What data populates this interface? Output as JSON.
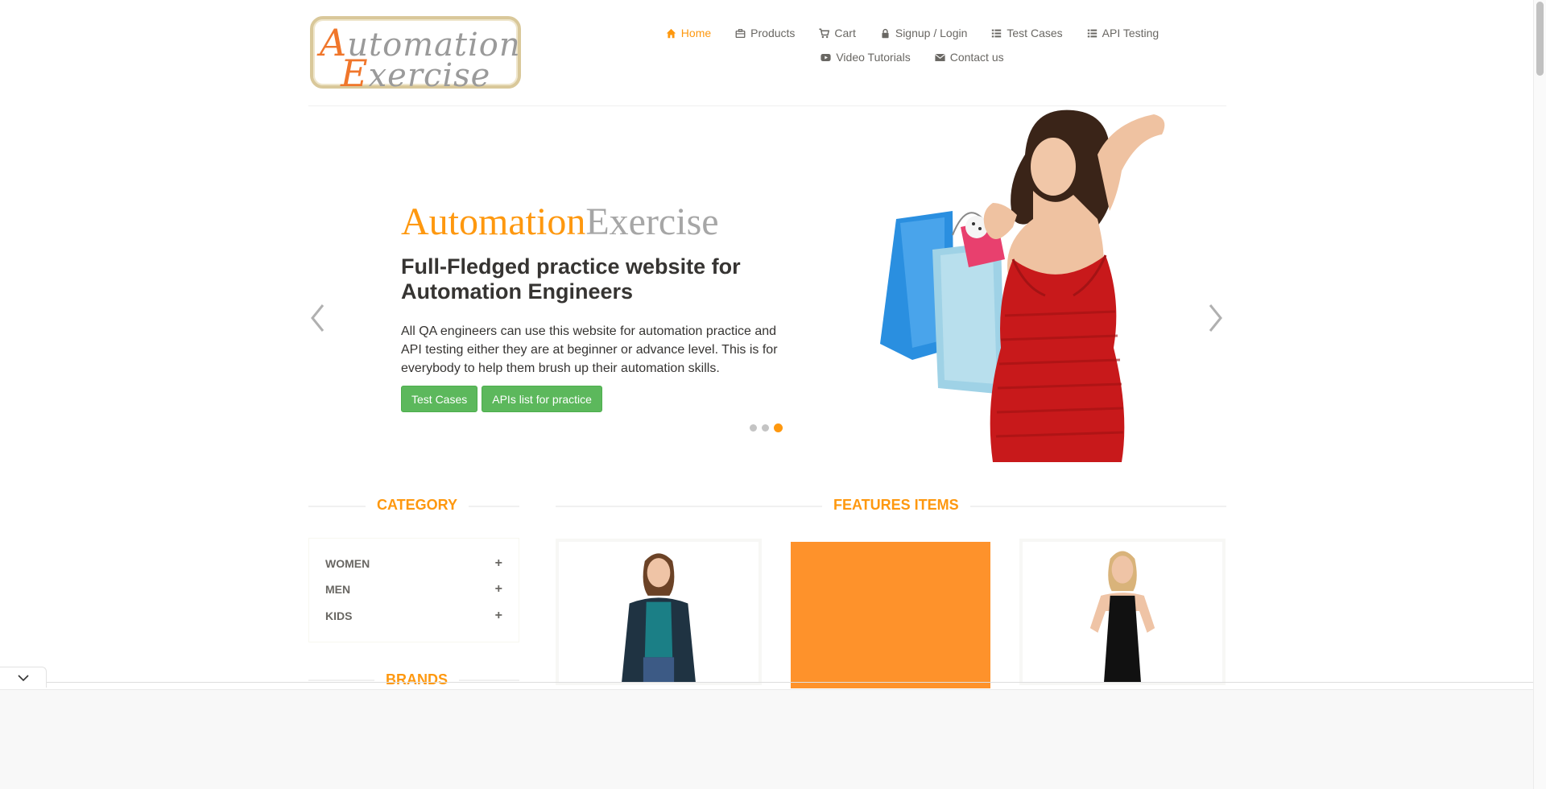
{
  "logo": {
    "line1_cap": "A",
    "line1_rest": "utomation",
    "line2_cap": "E",
    "line2_rest": "xercise",
    "alt": "Automation Exercise logo"
  },
  "nav": {
    "items": [
      {
        "label": "Home",
        "icon": "home-icon",
        "active": true
      },
      {
        "label": "Products",
        "icon": "briefcase-icon"
      },
      {
        "label": "Cart",
        "icon": "cart-icon"
      },
      {
        "label": "Signup / Login",
        "icon": "lock-icon"
      },
      {
        "label": "Test Cases",
        "icon": "list-icon"
      },
      {
        "label": "API Testing",
        "icon": "list-icon"
      },
      {
        "label": "Video Tutorials",
        "icon": "youtube-icon"
      },
      {
        "label": "Contact us",
        "icon": "envelope-icon"
      }
    ]
  },
  "slider": {
    "brand_a": "Automation",
    "brand_b": "Exercise",
    "headline": "Full-Fledged practice website for Automation Engineers",
    "body": "All QA engineers can use this website for automation practice and API testing either they are at beginner or advance level. This is for everybody to help them brush up their automation skills.",
    "buttons": [
      "Test Cases",
      "APIs list for practice"
    ],
    "active_slide": 3,
    "slide_count": 3
  },
  "sections": {
    "category": "CATEGORY",
    "features": "FEATURES ITEMS",
    "brands": "BRANDS"
  },
  "categories": [
    "WOMEN",
    "MEN",
    "KIDS"
  ],
  "colors": {
    "accent": "#fe980f",
    "button_green": "#5cb85c",
    "nav_text": "#696763",
    "dress_red": "#c8191b",
    "card_orange": "#fe922b"
  }
}
